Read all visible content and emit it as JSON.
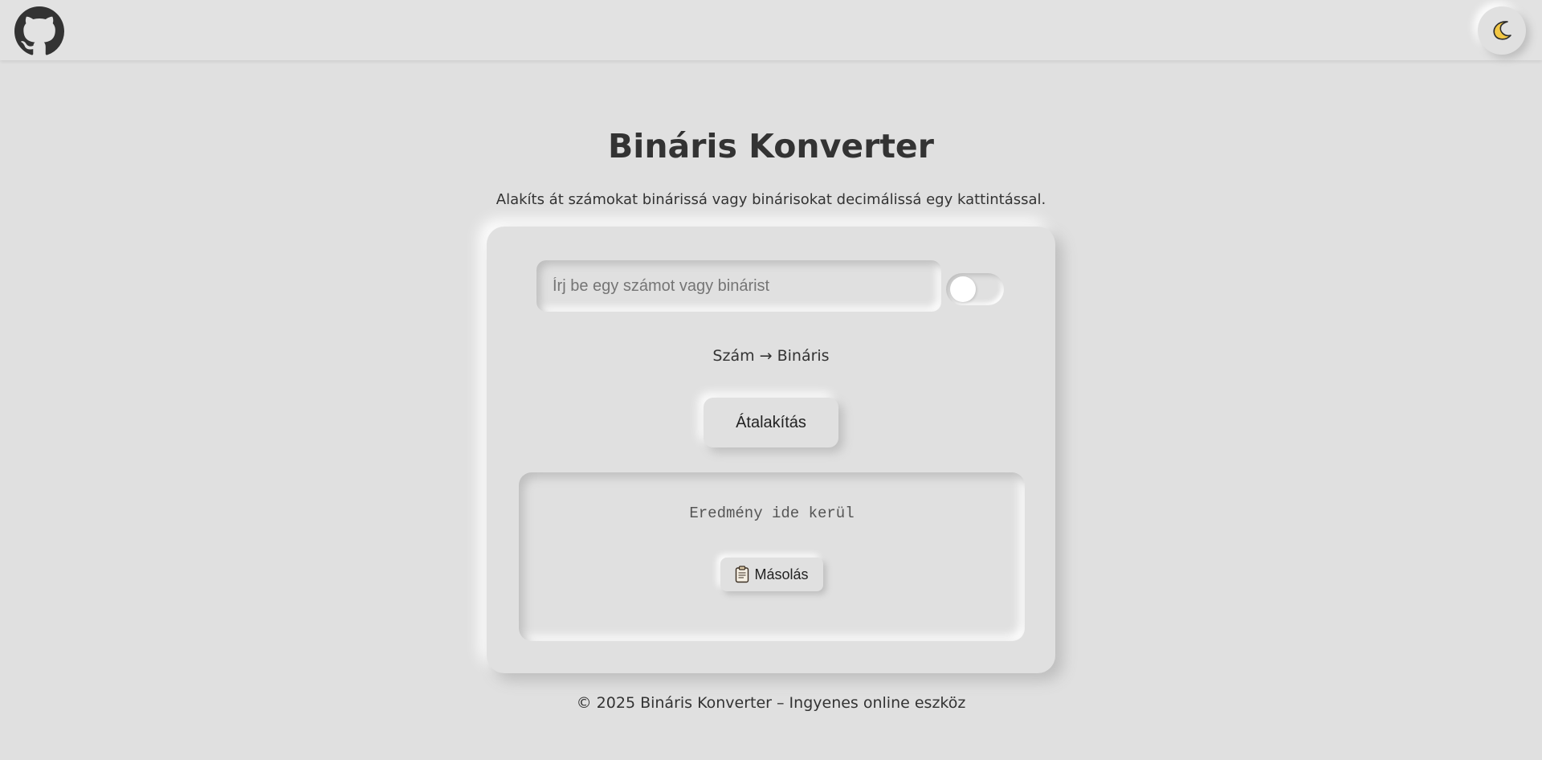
{
  "header": {
    "github_icon": "github-icon",
    "theme_icon": "moon-icon"
  },
  "main": {
    "title": "Bináris Konverter",
    "subtitle": "Alakíts át számokat binárissá vagy binárisokat decimálissá egy kattintással."
  },
  "converter": {
    "input_value": "",
    "input_placeholder": "Írj be egy számot vagy binárist",
    "mode_toggle_on": false,
    "mode_label": "Szám → Bináris",
    "convert_label": "Átalakítás",
    "result_placeholder": "Eredmény ide kerül",
    "copy_icon": "clipboard-icon",
    "copy_label": "Másolás"
  },
  "footer": {
    "text": "© 2025 Bináris Konverter – Ingyenes online eszköz"
  },
  "colors": {
    "background": "#e0e0e0",
    "text": "#333333",
    "moon": "#f2c744"
  }
}
